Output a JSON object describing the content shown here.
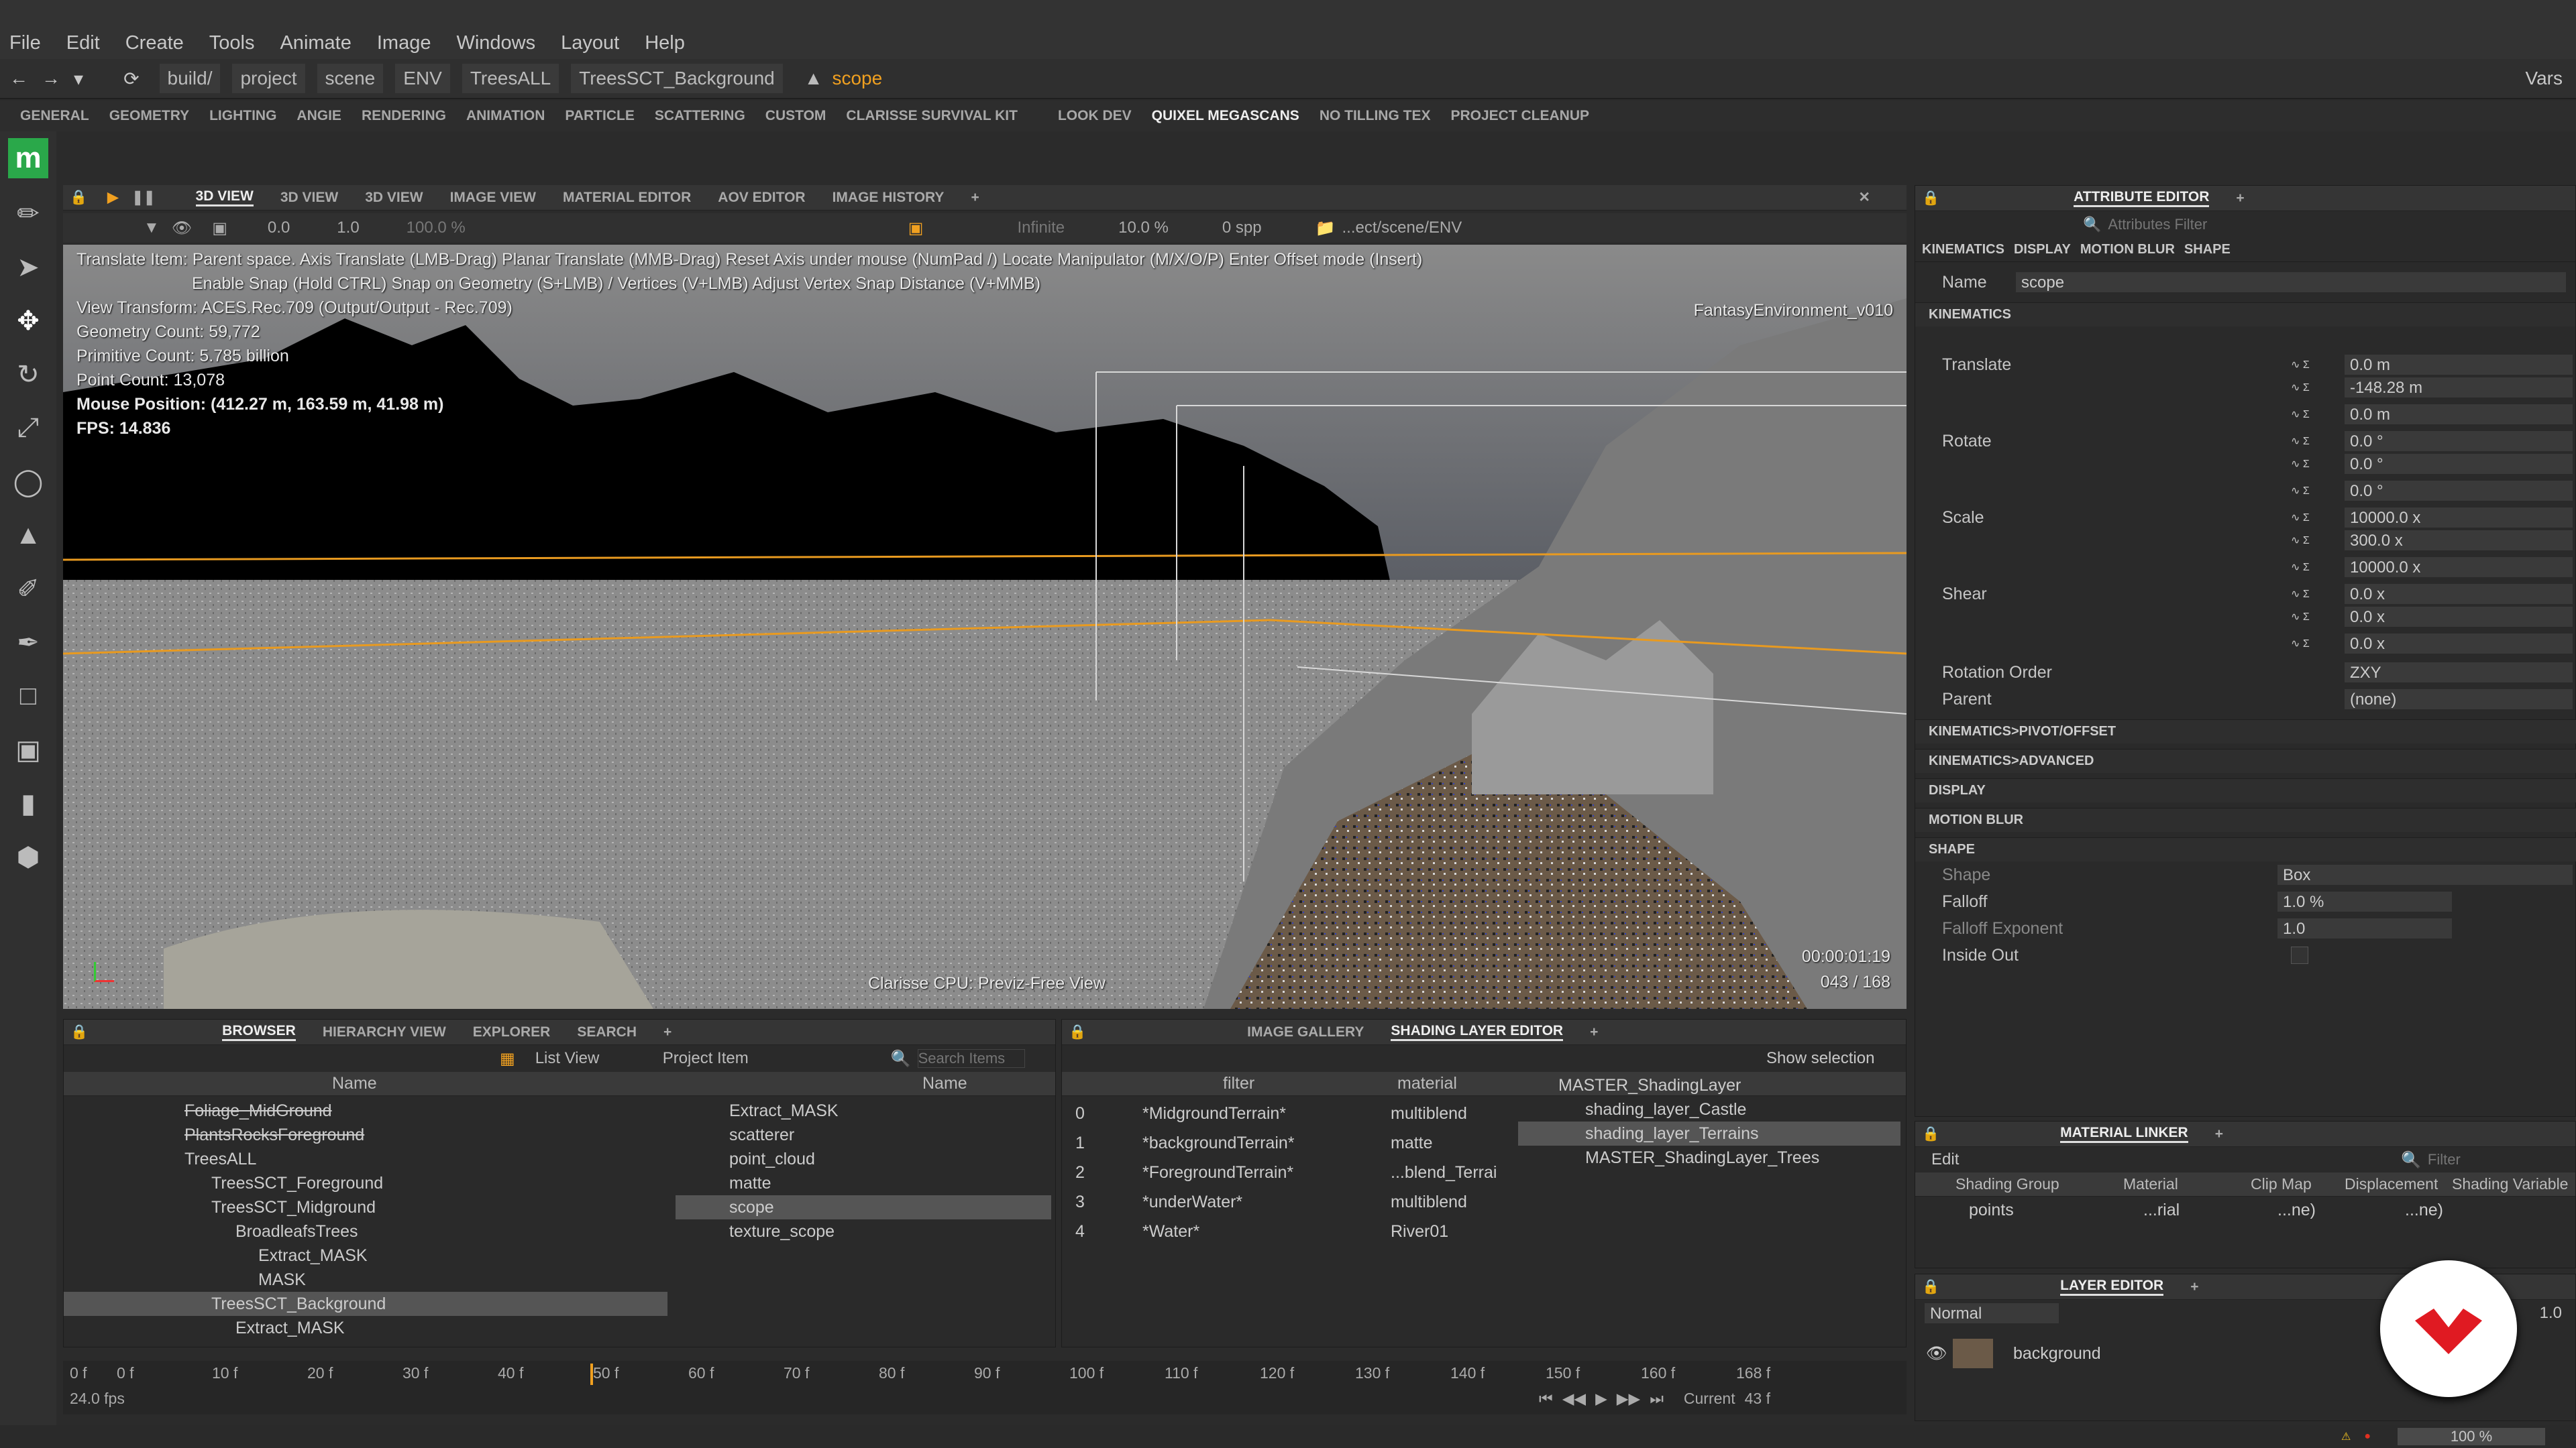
{
  "menu": [
    "File",
    "Edit",
    "Create",
    "Tools",
    "Animate",
    "Image",
    "Windows",
    "Layout",
    "Help"
  ],
  "path": {
    "crumbs": [
      "build/",
      "project",
      "scene",
      "ENV",
      "TreesALL",
      "TreesSCT_Background"
    ],
    "current": "scope",
    "vars": "Vars"
  },
  "shelf": [
    "GENERAL",
    "GEOMETRY",
    "LIGHTING",
    "ANGIE",
    "RENDERING",
    "ANIMATION",
    "PARTICLE",
    "SCATTERING",
    "CUSTOM",
    "CLARISSE SURVIVAL KIT",
    "LOOK DEV",
    "QUIXEL MEGASCANS",
    "NO TILLING TEX",
    "PROJECT CLEANUP"
  ],
  "viewtabs": [
    "3D VIEW",
    "3D VIEW",
    "3D VIEW",
    "IMAGE VIEW",
    "MATERIAL EDITOR",
    "AOV EDITOR",
    "IMAGE HISTORY"
  ],
  "viewtoolbar": {
    "v1": "0.0",
    "v2": "1.0",
    "v3": "100.0 %",
    "infinite": "Infinite",
    "pct": "10.0 %",
    "spp": "0 spp",
    "path": "...ect/scene/ENV"
  },
  "viewport": {
    "help1": "Translate Item: Parent space. Axis Translate (LMB-Drag) Planar Translate (MMB-Drag) Reset Axis under mouse (NumPad /) Locate Manipulator (M/X/O/P) Enter Offset mode (Insert)",
    "help2": "Enable Snap (Hold CTRL) Snap on Geometry (S+LMB) / Vertices (V+LMB) Adjust Vertex Snap Distance (V+MMB)",
    "stats": [
      "View Transform: ACES.Rec.709 (Output/Output - Rec.709)",
      "Geometry Count: 59,772",
      "Primitive Count: 5.785 billion",
      "Point Count: 13,078",
      "Mouse Position:  (412.27 m, 163.59 m, 41.98 m)",
      "FPS: 14.836"
    ],
    "env": "FantasyEnvironment_v010",
    "engine": "Clarisse CPU: Previz-Free View",
    "time": "00:00:01:19",
    "frame": "043 / 168"
  },
  "browser": {
    "tabs": [
      "BROWSER",
      "HIERARCHY VIEW",
      "EXPLORER",
      "SEARCH"
    ],
    "listview": "List View",
    "projectitem": "Project Item",
    "search": "Search Items",
    "colname": "Name",
    "tree": [
      {
        "t": "Foliage_MidGround",
        "d": 3,
        "strike": true
      },
      {
        "t": "PlantsRocksForeground",
        "d": 3,
        "strike": true
      },
      {
        "t": "TreesALL",
        "d": 2
      },
      {
        "t": "TreesSCT_Foreground",
        "d": 3
      },
      {
        "t": "TreesSCT_Midground",
        "d": 3
      },
      {
        "t": "BroadleafsTrees",
        "d": 4
      },
      {
        "t": "Extract_MASK",
        "d": 5
      },
      {
        "t": "MASK",
        "d": 5
      },
      {
        "t": "TreesSCT_Background",
        "d": 3,
        "sel": true
      },
      {
        "t": "Extract_MASK",
        "d": 4
      }
    ],
    "items": [
      "Extract_MASK",
      "scatterer",
      "point_cloud",
      "matte",
      "scope",
      "texture_scope"
    ]
  },
  "shading": {
    "tabs": [
      "IMAGE GALLERY",
      "SHADING LAYER EDITOR"
    ],
    "showsel": "Show selection",
    "cols": [
      "filter",
      "material"
    ],
    "rows": [
      {
        "i": "0",
        "f": "*MidgroundTerrain*",
        "m": "multiblend"
      },
      {
        "i": "1",
        "f": "*backgroundTerrain*",
        "m": "matte"
      },
      {
        "i": "2",
        "f": "*ForegroundTerrain*",
        "m": "...blend_Terrai"
      },
      {
        "i": "3",
        "f": "*underWater*",
        "m": "multiblend"
      },
      {
        "i": "4",
        "f": "*Water*",
        "m": "River01"
      }
    ],
    "tree": [
      "MASTER_ShadingLayer",
      "shading_layer_Castle",
      "shading_layer_Terrains",
      "MASTER_ShadingLayer_Trees"
    ]
  },
  "timeline": {
    "start": "0 f",
    "ticks": [
      "0 f",
      "10 f",
      "20 f",
      "30 f",
      "40 f",
      "50 f",
      "60 f",
      "70 f",
      "80 f",
      "90 f",
      "100 f",
      "110 f",
      "120 f",
      "130 f",
      "140 f",
      "150 f",
      "160 f"
    ],
    "end": "168 f",
    "fps": "24.0 fps",
    "current_label": "Current",
    "current": "43 f"
  },
  "attr": {
    "title": "ATTRIBUTE EDITOR",
    "filter": "Attributes Filter",
    "tabs": [
      "KINEMATICS",
      "DISPLAY",
      "MOTION BLUR",
      "SHAPE"
    ],
    "name_label": "Name",
    "name": "scope",
    "kin": "KINEMATICS",
    "translate": "Translate",
    "tvals": [
      "0.0 m",
      "-148.28 m",
      "0.0 m"
    ],
    "rotate": "Rotate",
    "rvals": [
      "0.0 °",
      "0.0 °",
      "0.0 °"
    ],
    "scale": "Scale",
    "svals": [
      "10000.0 x",
      "300.0 x",
      "10000.0 x"
    ],
    "shear": "Shear",
    "shvals": [
      "0.0 x",
      "0.0 x",
      "0.0 x"
    ],
    "rotorder": "Rotation Order",
    "rotorder_v": "ZXY",
    "parent": "Parent",
    "parent_v": "(none)",
    "sections": [
      "KINEMATICS>PIVOT/OFFSET",
      "KINEMATICS>ADVANCED",
      "DISPLAY",
      "MOTION BLUR"
    ],
    "shapesec": "SHAPE",
    "shape": "Shape",
    "shape_v": "Box",
    "falloff": "Falloff",
    "falloff_v": "1.0 %",
    "fexp": "Falloff Exponent",
    "fexp_v": "1.0",
    "inside": "Inside Out"
  },
  "matlinker": {
    "title": "MATERIAL LINKER",
    "edit": "Edit",
    "filter": "Filter",
    "cols": [
      "Shading Group",
      "Material",
      "Clip Map",
      "Displacement",
      "Shading Variable"
    ],
    "row": {
      "g": "points",
      "m": "...rial",
      "c": "...ne)",
      "d": "...ne)"
    }
  },
  "layer": {
    "title": "LAYER EDITOR",
    "mode": "Normal",
    "opacity": "1.0",
    "name": "background"
  },
  "status": {
    "zoom": "100 %"
  }
}
